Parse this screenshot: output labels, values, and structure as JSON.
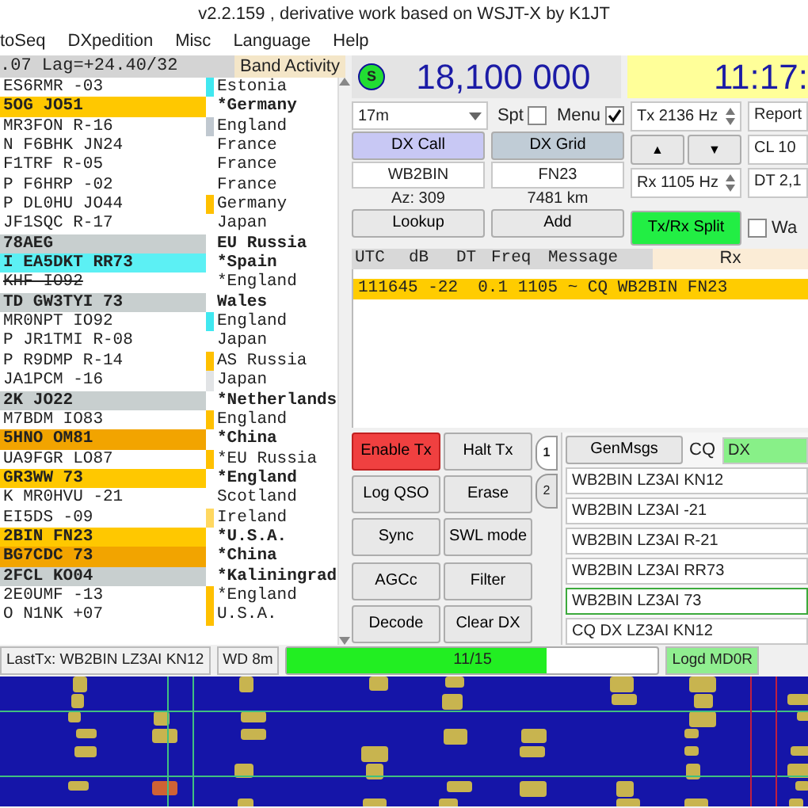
{
  "window": {
    "title": "v2.2.159 , derivative work based on WSJT-X by K1JT"
  },
  "menu": [
    "toSeq",
    "DXpedition",
    "Misc",
    "Language",
    "Help"
  ],
  "band_activity": {
    "status": ".07 Lag=+24.40/32",
    "title": "Band Activity",
    "rows": [
      {
        "kind": "plain",
        "message": "ES6RMR -03",
        "country": "Estonia",
        "color": "#40e8f0"
      },
      {
        "kind": "cq",
        "message": "5OG JO51",
        "country": "*Germany",
        "bold": true
      },
      {
        "kind": "plain",
        "message": "MR3FON R-16",
        "country": "England",
        "color": "#c0c8d0"
      },
      {
        "kind": "plain",
        "message": "N F6BHK JN24",
        "country": "France"
      },
      {
        "kind": "plain",
        "message": "F1TRF R-05",
        "country": "France"
      },
      {
        "kind": "plain",
        "message": "P F6HRP -02",
        "country": "France"
      },
      {
        "kind": "plain",
        "message": "P DL0HU JO44",
        "country": "Germany",
        "color": "#ffc000"
      },
      {
        "kind": "plain",
        "message": "JF1SQC R-17",
        "country": "Japan"
      },
      {
        "kind": "worked",
        "message": "78AEG",
        "country": "EU Russia",
        "bold": true
      },
      {
        "kind": "to_me",
        "message": "I EA5DKT RR73",
        "country": "*Spain",
        "bold": true
      },
      {
        "kind": "plain",
        "message": "KHF IO92",
        "country": "*England",
        "struck": true
      },
      {
        "kind": "worked",
        "message": "TD GW3TYI 73",
        "country": "Wales",
        "bold": true
      },
      {
        "kind": "plain",
        "message": "MR0NPT IO92",
        "country": "England",
        "color": "#40e8f0"
      },
      {
        "kind": "plain",
        "message": "P JR1TMI R-08",
        "country": "Japan"
      },
      {
        "kind": "plain",
        "message": "P R9DMP R-14",
        "country": "AS Russia",
        "color": "#ffc000"
      },
      {
        "kind": "plain",
        "message": "JA1PCM -16",
        "country": "Japan",
        "color": "#e2e4e6"
      },
      {
        "kind": "worked",
        "message": "2K JO22",
        "country": "*Netherlands",
        "bold": true
      },
      {
        "kind": "plain",
        "message": "M7BDM IO83",
        "country": "England",
        "color": "#ffc000"
      },
      {
        "kind": "new_call",
        "message": "5HNO OM81",
        "country": "*China",
        "bold": true
      },
      {
        "kind": "plain",
        "message": "UA9FGR LO87",
        "country": "*EU Russia",
        "color": "#ffc000"
      },
      {
        "kind": "cq",
        "message": "GR3WW 73",
        "country": "*England",
        "bold": true
      },
      {
        "kind": "plain",
        "message": "K MR0HVU -21",
        "country": "Scotland"
      },
      {
        "kind": "plain",
        "message": "EI5DS -09",
        "country": "Ireland",
        "color": "#ffd860"
      },
      {
        "kind": "cq",
        "message": "2BIN FN23",
        "country": "*U.S.A.",
        "bold": true
      },
      {
        "kind": "new_call",
        "message": "BG7CDC 73",
        "country": "*China",
        "bold": true
      },
      {
        "kind": "worked",
        "message": "2FCL KO04",
        "country": "*Kaliningrad",
        "bold": true
      },
      {
        "kind": "plain",
        "message": "2E0UMF -13",
        "country": "*England",
        "color": "#ffc000"
      },
      {
        "kind": "plain",
        "message": "O N1NK +07",
        "country": "U.S.A.",
        "color": "#ffc000"
      }
    ]
  },
  "control": {
    "indicator": "S",
    "frequency": "18,100 000",
    "clock": "11:17:",
    "band": "17m",
    "spot": {
      "label": "Spt",
      "checked": false
    },
    "menu_toggle": {
      "label": "Menu",
      "checked": true
    },
    "tx_freq": "Tx  2136  Hz",
    "report": "Report",
    "up": "▲",
    "down": "▼",
    "cl": "CL  10",
    "rx_freq": "Rx  1105  Hz",
    "dt": "DT 2,1",
    "dx_call": {
      "label": "DX Call",
      "value": "WB2BIN",
      "info": "Az: 309",
      "action": "Lookup"
    },
    "dx_grid": {
      "label": "DX Grid",
      "value": "FN23",
      "info": "7481 km",
      "action": "Add"
    },
    "split": "Tx/Rx Split",
    "wait": {
      "label": "Wa",
      "checked": false
    }
  },
  "rx_pane": {
    "columns": [
      "UTC",
      "dB",
      "DT",
      "Freq",
      "Message"
    ],
    "title": "Rx",
    "lines": [
      "111645 -22  0.1 1105 ~ CQ WB2BIN FN23"
    ]
  },
  "buttons": [
    {
      "label": "Enable Tx",
      "on": true
    },
    {
      "label": "Halt Tx",
      "on": false
    },
    {
      "label": "Log QSO",
      "on": false
    },
    {
      "label": "Erase",
      "on": false
    },
    {
      "label": "Sync",
      "on": false
    },
    {
      "label": "SWL mode",
      "on": false
    },
    {
      "label": "AGCc",
      "on": false
    },
    {
      "label": "Filter",
      "on": false
    },
    {
      "label": "Decode",
      "on": false
    },
    {
      "label": "Clear DX",
      "on": false
    }
  ],
  "tabs": [
    {
      "label": "1",
      "selected": true
    },
    {
      "label": "2",
      "selected": false
    }
  ],
  "gen": {
    "button": "GenMsgs",
    "cq_label": "CQ",
    "cq_value": "DX"
  },
  "messages": [
    {
      "text": "WB2BIN LZ3AI KN12",
      "selected": false
    },
    {
      "text": "WB2BIN LZ3AI -21",
      "selected": false
    },
    {
      "text": "WB2BIN LZ3AI R-21",
      "selected": false
    },
    {
      "text": "WB2BIN LZ3AI RR73",
      "selected": false
    },
    {
      "text": "WB2BIN LZ3AI 73",
      "selected": true
    },
    {
      "text": "CQ DX LZ3AI KN12",
      "selected": false
    }
  ],
  "status_bar": {
    "last_tx": "LastTx: WB2BIN LZ3AI KN12",
    "wd": "WD 8m",
    "progress": {
      "text": "11/15",
      "level": 0.7
    },
    "logged": "Logd MD0R"
  }
}
